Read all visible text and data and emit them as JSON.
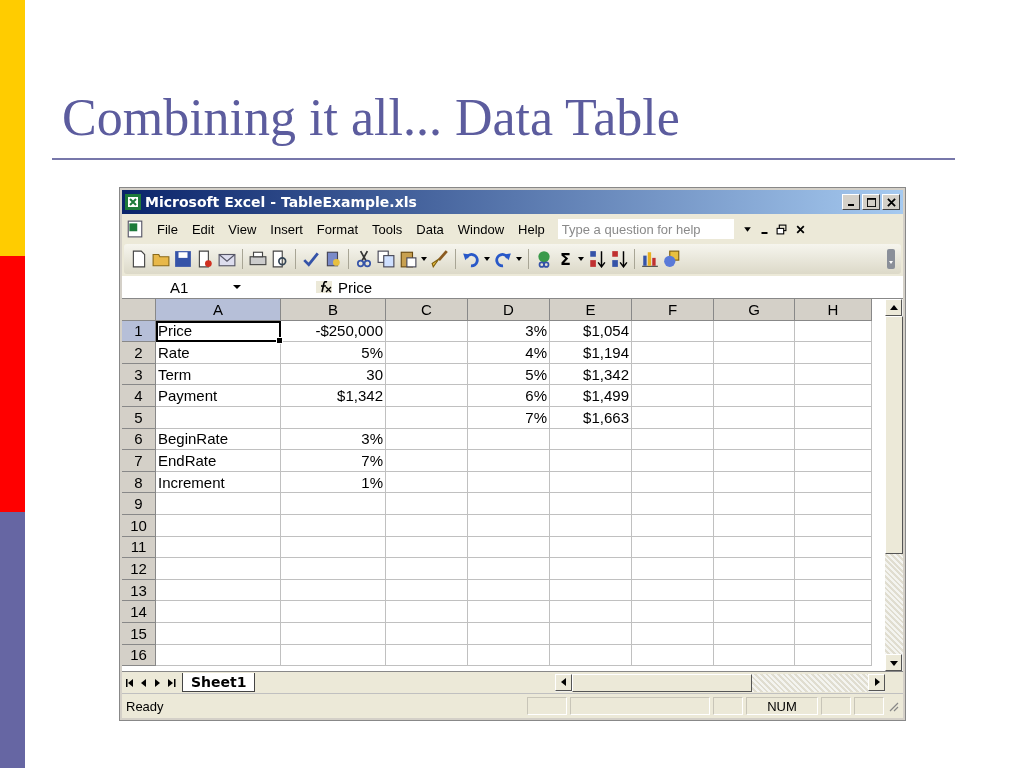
{
  "slide": {
    "title": "Combining it all... Data Table"
  },
  "window": {
    "title": "Microsoft Excel - TableExample.xls"
  },
  "menu": [
    "File",
    "Edit",
    "View",
    "Insert",
    "Format",
    "Tools",
    "Data",
    "Window",
    "Help"
  ],
  "help_search": {
    "placeholder": "Type a question for help"
  },
  "toolbar": {
    "sum_symbol": "Σ"
  },
  "formula_bar": {
    "name_box": "A1",
    "formula": "Price"
  },
  "columns": [
    {
      "label": "A",
      "selected": true
    },
    {
      "label": "B",
      "selected": false
    },
    {
      "label": "C",
      "selected": false
    },
    {
      "label": "D",
      "selected": false
    },
    {
      "label": "E",
      "selected": false
    },
    {
      "label": "F",
      "selected": false
    },
    {
      "label": "G",
      "selected": false
    },
    {
      "label": "H",
      "selected": false
    }
  ],
  "rows": [
    {
      "label": "1",
      "selected": true,
      "cells": [
        "Price",
        "-$250,000",
        null,
        "3%",
        "$1,054",
        null,
        null,
        null
      ]
    },
    {
      "label": "2",
      "selected": false,
      "cells": [
        "Rate",
        "5%",
        null,
        "4%",
        "$1,194",
        null,
        null,
        null
      ]
    },
    {
      "label": "3",
      "selected": false,
      "cells": [
        "Term",
        "30",
        null,
        "5%",
        "$1,342",
        null,
        null,
        null
      ]
    },
    {
      "label": "4",
      "selected": false,
      "cells": [
        "Payment",
        "$1,342",
        null,
        "6%",
        "$1,499",
        null,
        null,
        null
      ]
    },
    {
      "label": "5",
      "selected": false,
      "cells": [
        null,
        null,
        null,
        "7%",
        "$1,663",
        null,
        null,
        null
      ]
    },
    {
      "label": "6",
      "selected": false,
      "cells": [
        "BeginRate",
        "3%",
        null,
        null,
        null,
        null,
        null,
        null
      ]
    },
    {
      "label": "7",
      "selected": false,
      "cells": [
        "EndRate",
        "7%",
        null,
        null,
        null,
        null,
        null,
        null
      ]
    },
    {
      "label": "8",
      "selected": false,
      "cells": [
        "Increment",
        "1%",
        null,
        null,
        null,
        null,
        null,
        null
      ]
    },
    {
      "label": "9",
      "selected": false,
      "cells": [
        null,
        null,
        null,
        null,
        null,
        null,
        null,
        null
      ]
    },
    {
      "label": "10",
      "selected": false,
      "cells": [
        null,
        null,
        null,
        null,
        null,
        null,
        null,
        null
      ]
    },
    {
      "label": "11",
      "selected": false,
      "cells": [
        null,
        null,
        null,
        null,
        null,
        null,
        null,
        null
      ]
    },
    {
      "label": "12",
      "selected": false,
      "cells": [
        null,
        null,
        null,
        null,
        null,
        null,
        null,
        null
      ]
    },
    {
      "label": "13",
      "selected": false,
      "cells": [
        null,
        null,
        null,
        null,
        null,
        null,
        null,
        null
      ]
    },
    {
      "label": "14",
      "selected": false,
      "cells": [
        null,
        null,
        null,
        null,
        null,
        null,
        null,
        null
      ]
    },
    {
      "label": "15",
      "selected": false,
      "cells": [
        null,
        null,
        null,
        null,
        null,
        null,
        null,
        null
      ]
    },
    {
      "label": "16",
      "selected": false,
      "cells": [
        null,
        null,
        null,
        null,
        null,
        null,
        null,
        null
      ]
    }
  ],
  "sheet_tabs": [
    {
      "label": "Sheet1",
      "selected": true
    }
  ],
  "status_bar": {
    "status": "Ready",
    "indicators": [
      "NUM"
    ]
  }
}
